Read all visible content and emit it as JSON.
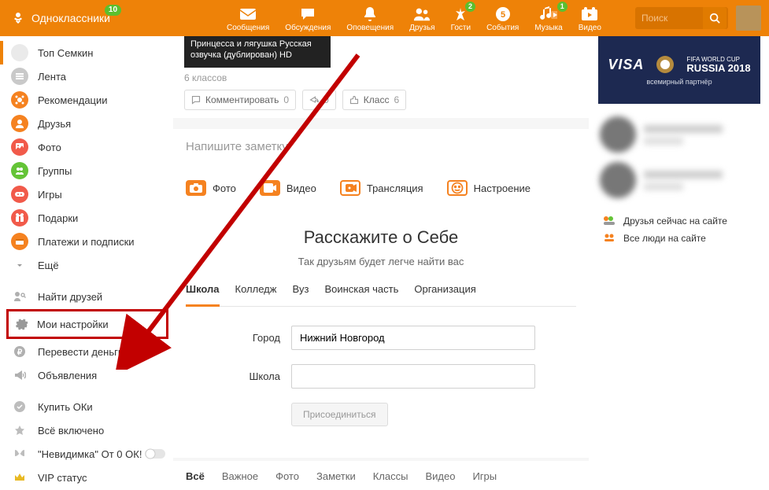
{
  "header": {
    "logo_text": "Одноклассники",
    "logo_badge": "10",
    "nav": [
      {
        "label": "Сообщения",
        "name": "messages"
      },
      {
        "label": "Обсуждения",
        "name": "discussions"
      },
      {
        "label": "Оповещения",
        "name": "notifications"
      },
      {
        "label": "Друзья",
        "name": "friends"
      },
      {
        "label": "Гости",
        "name": "guests",
        "badge": "2"
      },
      {
        "label": "События",
        "name": "events"
      },
      {
        "label": "Музыка",
        "name": "music",
        "badge": "1"
      },
      {
        "label": "Видео",
        "name": "video"
      }
    ],
    "search_placeholder": "Поиск"
  },
  "sidebar": {
    "profile_name": "Топ Семкин",
    "items": [
      {
        "label": "Лента",
        "name": "feed"
      },
      {
        "label": "Рекомендации",
        "name": "recommendations"
      },
      {
        "label": "Друзья",
        "name": "friends"
      },
      {
        "label": "Фото",
        "name": "photos"
      },
      {
        "label": "Группы",
        "name": "groups"
      },
      {
        "label": "Игры",
        "name": "games"
      },
      {
        "label": "Подарки",
        "name": "gifts"
      },
      {
        "label": "Платежи и подписки",
        "name": "payments"
      },
      {
        "label": "Ещё",
        "name": "more"
      }
    ],
    "secondary": [
      {
        "label": "Найти друзей",
        "name": "find-friends"
      },
      {
        "label": "Мои настройки",
        "name": "my-settings",
        "highlighted": true
      },
      {
        "label": "Перевести деньги",
        "name": "transfer-money"
      },
      {
        "label": "Объявления",
        "name": "ads"
      }
    ],
    "extras": [
      {
        "label": "Купить ОКи",
        "name": "buy-oks"
      },
      {
        "label": "Всё включено",
        "name": "all-inclusive"
      },
      {
        "label": "\"Невидимка\" От 0 ОК!",
        "name": "invisible"
      },
      {
        "label": "VIP статус",
        "name": "vip"
      }
    ]
  },
  "post": {
    "thumb_text": "Принцесса и лягушка Русская озвучка (дублирован) HD",
    "likes_text": "6 классов",
    "comment_label": "Комментировать",
    "comment_count": "0",
    "share_count": "0",
    "class_label": "Класс",
    "class_count": "6"
  },
  "composer": {
    "title": "Напишите заметку",
    "actions": [
      {
        "label": "Фото",
        "name": "photo",
        "style": "solid"
      },
      {
        "label": "Видео",
        "name": "video",
        "style": "solid"
      },
      {
        "label": "Трансляция",
        "name": "stream",
        "style": "outline"
      },
      {
        "label": "Настроение",
        "name": "mood",
        "style": "outline"
      }
    ]
  },
  "about": {
    "heading": "Расскажите о Себе",
    "subtitle": "Так друзьям будет легче найти вас",
    "tabs": [
      "Школа",
      "Колледж",
      "Вуз",
      "Воинская часть",
      "Организация"
    ],
    "active_tab": 0,
    "form": {
      "city_label": "Город",
      "city_value": "Нижний Новгород",
      "school_label": "Школа",
      "school_value": "",
      "join_label": "Присоединиться"
    }
  },
  "filter_tabs": [
    "Всё",
    "Важное",
    "Фото",
    "Заметки",
    "Классы",
    "Видео",
    "Игры"
  ],
  "filter_active": 0,
  "right": {
    "ad": {
      "visa": "VISA",
      "event": "RUSSIA 2018",
      "event_pre": "FIFA WORLD CUP",
      "partner": "всемирный партнёр"
    },
    "online_friends_label": "Друзья сейчас на сайте",
    "all_people_label": "Все люди на сайте"
  }
}
